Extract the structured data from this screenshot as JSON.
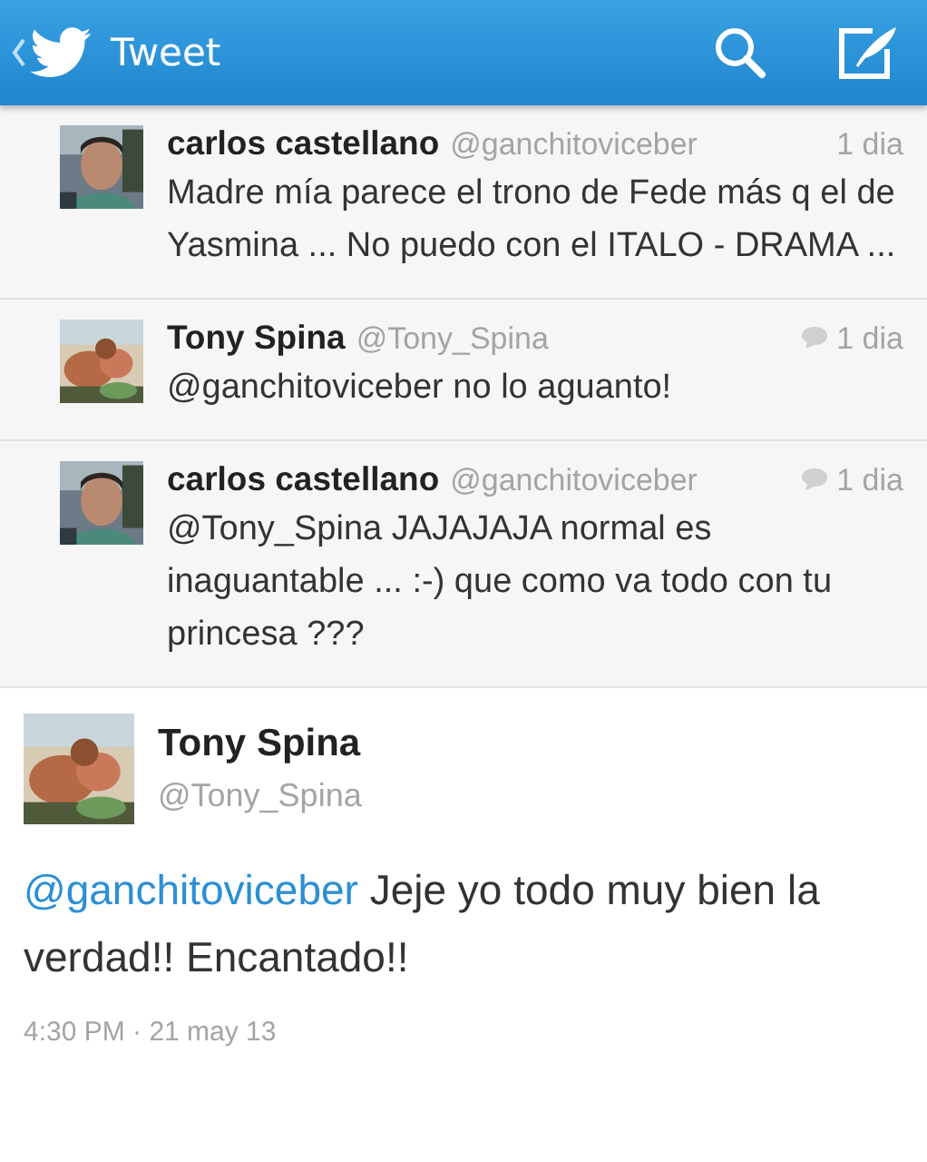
{
  "header": {
    "title": "Tweet"
  },
  "replies": [
    {
      "name": "carlos castellano",
      "handle": "@ganchitoviceber",
      "time": "1 dia",
      "conversation": false,
      "text": "Madre mía parece el trono de Fede más q el de Yasmina ... No puedo con el ITALO - DRAMA ..."
    },
    {
      "name": "Tony Spina",
      "handle": "@Tony_Spina",
      "time": "1 dia",
      "conversation": true,
      "text": "@ganchitoviceber no lo aguanto!"
    },
    {
      "name": "carlos castellano",
      "handle": "@ganchitoviceber",
      "time": "1 dia",
      "conversation": true,
      "text": "@Tony_Spina JAJAJAJA normal es inaguantable ... :-) que como va todo con tu princesa ???"
    }
  ],
  "tweet": {
    "name": "Tony Spina",
    "handle": "@Tony_Spina",
    "mention": "@ganchitoviceber",
    "text": "Jeje yo todo muy bien la verdad!! Encantado!!",
    "timestamp": "4:30 PM · 21 may 13"
  }
}
